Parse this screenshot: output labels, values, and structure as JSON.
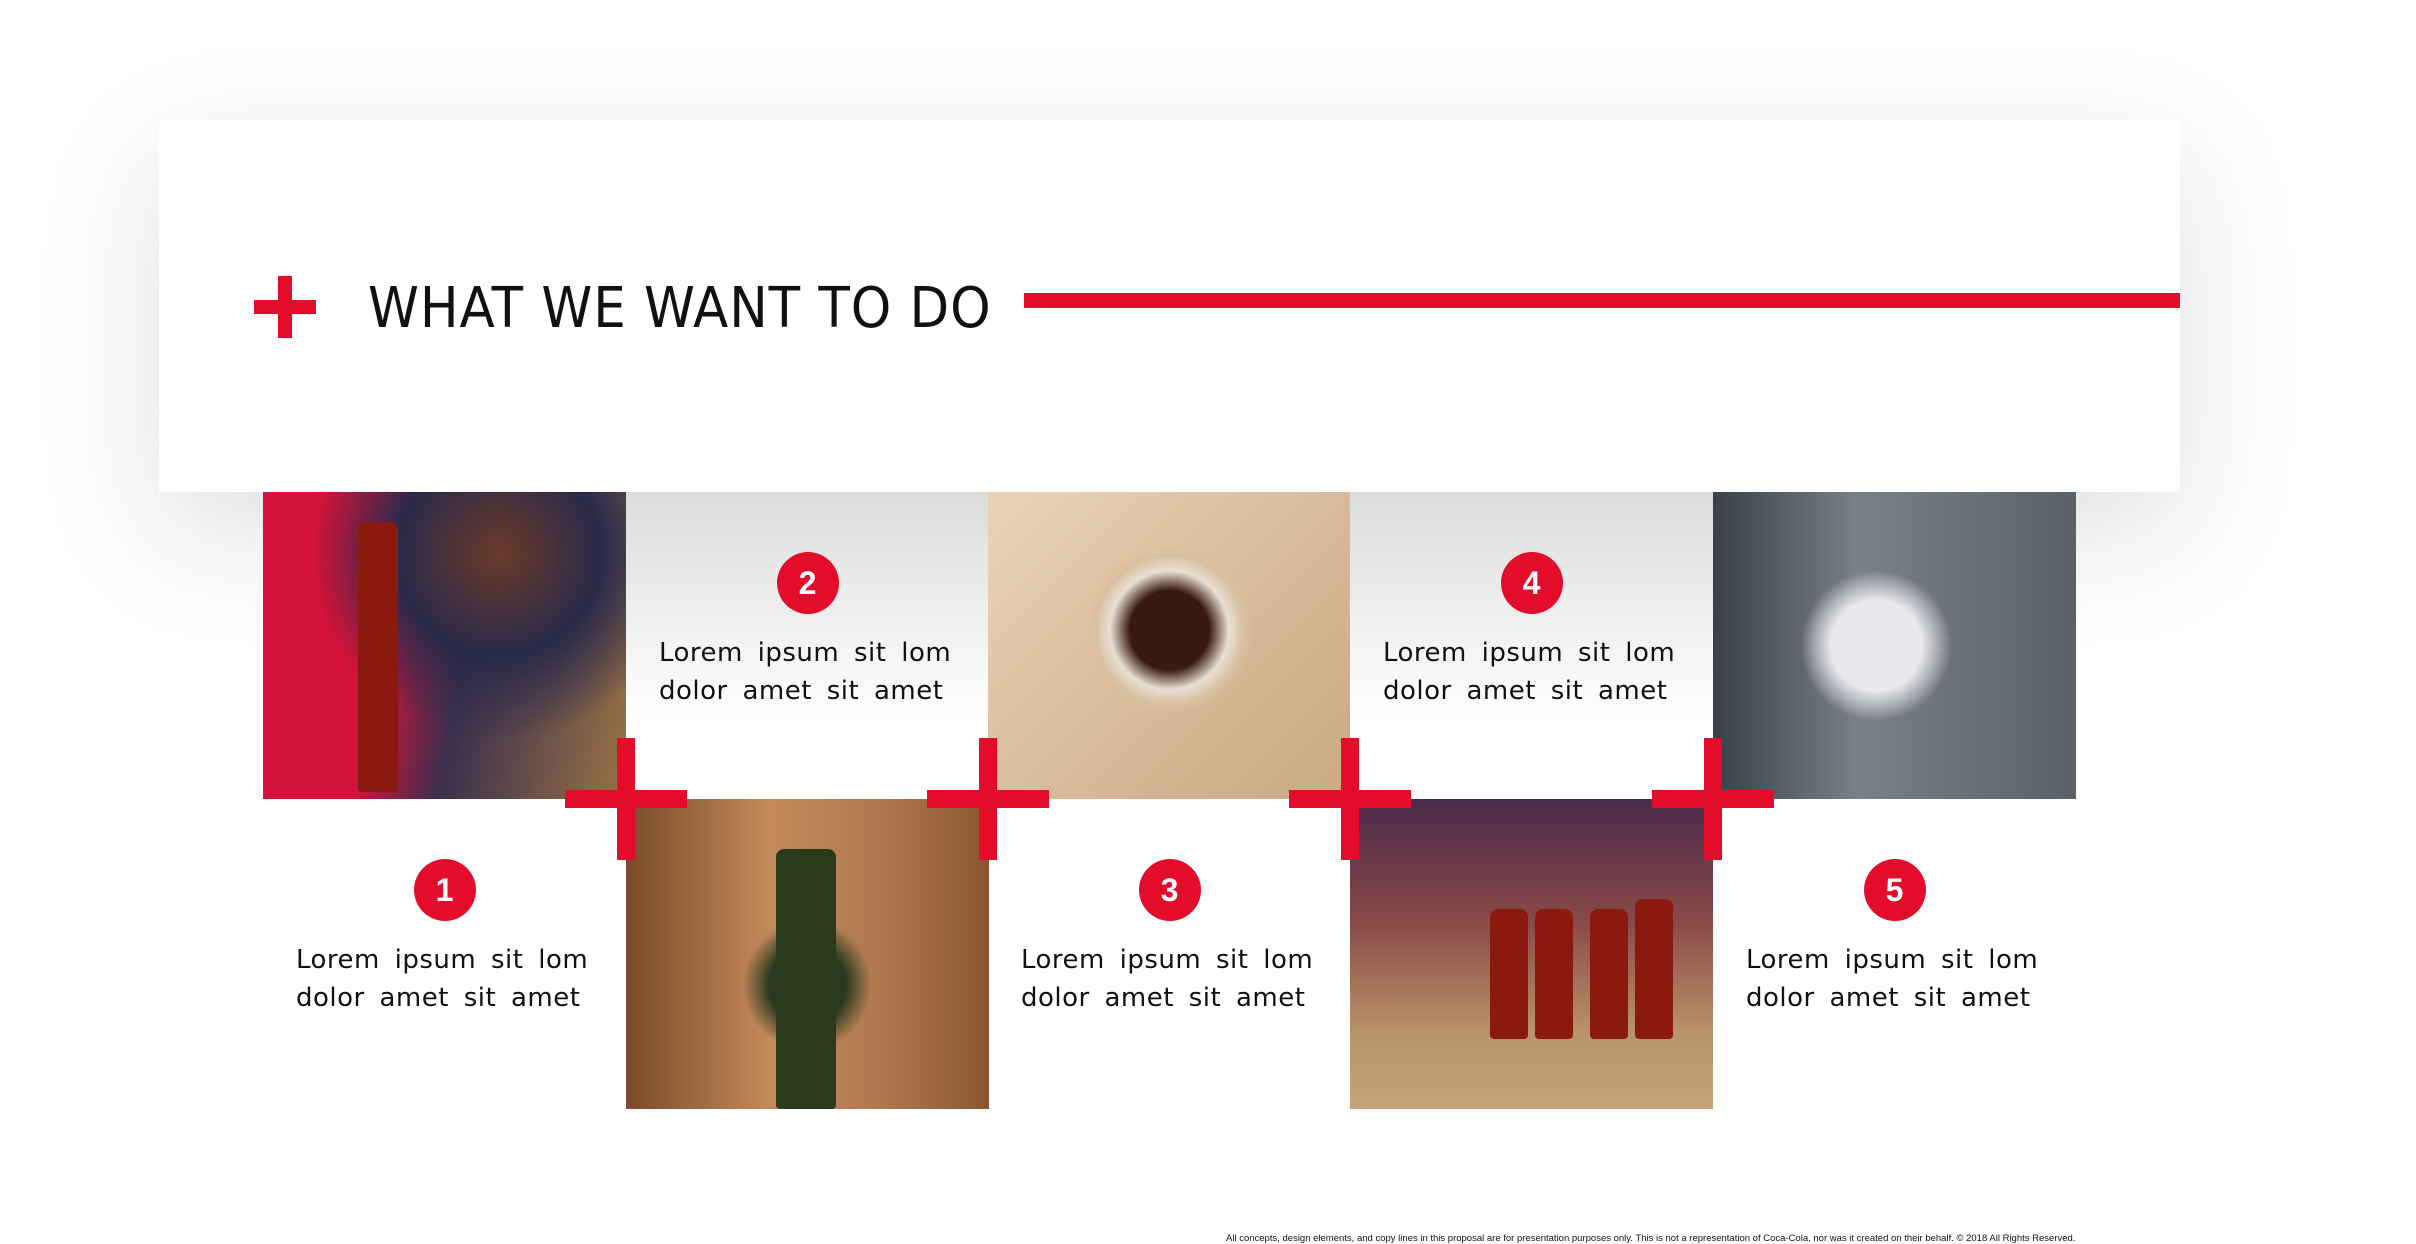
{
  "header": {
    "title": "WHAT WE WANT TO DO"
  },
  "steps": [
    {
      "number": "1",
      "line1": "Lorem ipsum sit lom",
      "line2": "dolor amet sit amet"
    },
    {
      "number": "2",
      "line1": "Lorem ipsum sit lom",
      "line2": "dolor amet sit amet"
    },
    {
      "number": "3",
      "line1": "Lorem ipsum sit lom",
      "line2": "dolor amet sit amet"
    },
    {
      "number": "4",
      "line1": "Lorem ipsum sit lom",
      "line2": "dolor amet sit amet"
    },
    {
      "number": "5",
      "line1": "Lorem ipsum sit lom",
      "line2": "dolor amet sit amet"
    }
  ],
  "footer": {
    "disclaimer": "All concepts, design elements, and copy lines in this proposal are for presentation purposes only. This is not a representation of Coca-Cola, nor was it created on their behalf.  © 2018 All Rights Reserved."
  },
  "colors": {
    "accent": "#e30d2b"
  }
}
